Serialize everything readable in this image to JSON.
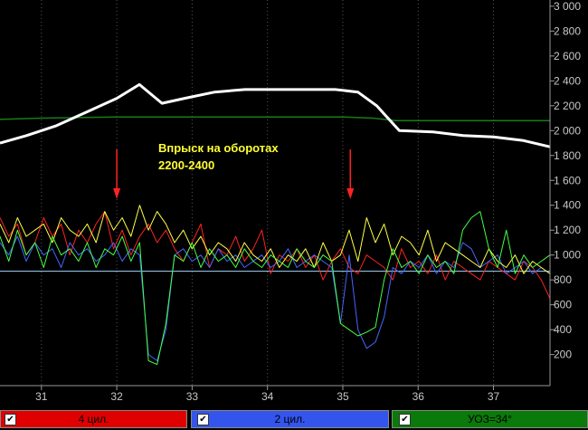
{
  "chart_data": {
    "type": "line",
    "annotation": {
      "line1": "Впрыск на оборотах",
      "line2": "2200-2400"
    },
    "arrows_at_x": [
      32.0,
      35.1
    ],
    "x_ticks": [
      "31",
      "32",
      "33",
      "34",
      "35",
      "36",
      "37"
    ],
    "y_ticks": [
      "200",
      "400",
      "600",
      "800",
      "1 000",
      "1 200",
      "1 400",
      "1 600",
      "1 800",
      "2 000",
      "2 200",
      "2 400",
      "2 600",
      "2 800",
      "3 000"
    ],
    "xlim": [
      30.45,
      37.75
    ],
    "ylim": [
      -50,
      3050
    ],
    "grid": "vertical-dotted",
    "reference_line_y": 870,
    "rpm_series": {
      "color": "#ffffff",
      "points": [
        [
          30.45,
          1900
        ],
        [
          30.8,
          1960
        ],
        [
          31.2,
          2040
        ],
        [
          31.6,
          2150
        ],
        [
          32.0,
          2260
        ],
        [
          32.3,
          2370
        ],
        [
          32.6,
          2220
        ],
        [
          32.9,
          2260
        ],
        [
          33.3,
          2310
        ],
        [
          33.7,
          2330
        ],
        [
          34.1,
          2330
        ],
        [
          34.5,
          2330
        ],
        [
          34.9,
          2330
        ],
        [
          35.2,
          2310
        ],
        [
          35.45,
          2200
        ],
        [
          35.75,
          2000
        ],
        [
          36.2,
          1990
        ],
        [
          36.6,
          1960
        ],
        [
          37.0,
          1950
        ],
        [
          37.4,
          1920
        ],
        [
          37.75,
          1870
        ]
      ]
    },
    "sync_series": {
      "color": "#1a7a1a",
      "points": [
        [
          30.45,
          2090
        ],
        [
          31.0,
          2100
        ],
        [
          32.0,
          2110
        ],
        [
          33.0,
          2110
        ],
        [
          34.0,
          2110
        ],
        [
          35.0,
          2110
        ],
        [
          35.4,
          2100
        ],
        [
          35.7,
          2080
        ],
        [
          37.75,
          2080
        ]
      ]
    },
    "series": [
      {
        "name": "4 цил.",
        "color": "#ff2222",
        "values": [
          1300,
          1150,
          1250,
          1000,
          1100,
          1300,
          1150,
          1250,
          1000,
          1200,
          1100,
          1250,
          1350,
          1050,
          1200,
          1000,
          1150,
          1250,
          1100,
          1200,
          1050,
          950,
          1100,
          1250,
          900,
          1050,
          1000,
          1150,
          950,
          1050,
          1200,
          850,
          1000,
          950,
          1050,
          900,
          1000,
          800,
          950,
          1050,
          900,
          850,
          1000,
          950,
          900,
          800,
          1050,
          900,
          950,
          850,
          1000,
          800,
          950,
          900,
          850,
          800,
          950,
          900,
          850,
          800,
          950,
          900,
          800,
          650
        ]
      },
      {
        "name": "2 цил.",
        "color": "#4466ff",
        "values": [
          1100,
          1000,
          1150,
          950,
          1100,
          1000,
          1050,
          900,
          1100,
          1000,
          1050,
          950,
          1000,
          1100,
          950,
          1050,
          1000,
          200,
          150,
          400,
          1000,
          1050,
          950,
          1000,
          900,
          1050,
          950,
          1000,
          900,
          950,
          1000,
          900,
          950,
          1050,
          900,
          950,
          1000,
          950,
          900,
          450,
          1000,
          400,
          250,
          300,
          500,
          900,
          850,
          950,
          900,
          1000,
          850,
          950,
          900,
          1100,
          1050,
          900,
          950,
          1000,
          850,
          900,
          950,
          850,
          900,
          850
        ]
      },
      {
        "name": "",
        "color": "#ffff44",
        "values": [
          1250,
          1100,
          1300,
          1150,
          1200,
          1250,
          1100,
          1300,
          1200,
          1150,
          1250,
          1100,
          1350,
          1200,
          1300,
          1150,
          1400,
          1200,
          1350,
          1250,
          1100,
          1200,
          1050,
          1150,
          1000,
          1100,
          1050,
          950,
          1100,
          1000,
          950,
          1050,
          900,
          1000,
          950,
          1050,
          900,
          1100,
          950,
          1000,
          1200,
          950,
          1300,
          1100,
          1250,
          1000,
          1150,
          1100,
          1000,
          1200,
          950,
          1100,
          1050,
          1000,
          950,
          900,
          1050,
          950,
          900,
          1000,
          850,
          950,
          900,
          850
        ]
      },
      {
        "name": "",
        "color": "#44ff44",
        "values": [
          1150,
          950,
          1200,
          1000,
          1100,
          900,
          1150,
          1000,
          1050,
          950,
          1100,
          900,
          1050,
          1000,
          1150,
          950,
          1100,
          150,
          120,
          450,
          1000,
          950,
          1100,
          900,
          1050,
          950,
          1000,
          900,
          1050,
          950,
          900,
          1000,
          950,
          900,
          1050,
          950,
          900,
          1000,
          950,
          450,
          400,
          350,
          380,
          420,
          800,
          1050,
          900,
          950,
          850,
          1000,
          900,
          950,
          850,
          1200,
          1300,
          1350,
          1050,
          900,
          1200,
          850,
          1000,
          900,
          950,
          1000
        ]
      }
    ]
  },
  "legend": [
    {
      "label": "4 цил.",
      "color": "#ff2222",
      "checked": "✔"
    },
    {
      "label": "2 цил.",
      "color": "#4466ff",
      "checked": "✔"
    },
    {
      "label": "УОЗ=34°",
      "color": "#1a8a1a",
      "checked": "✔"
    }
  ]
}
